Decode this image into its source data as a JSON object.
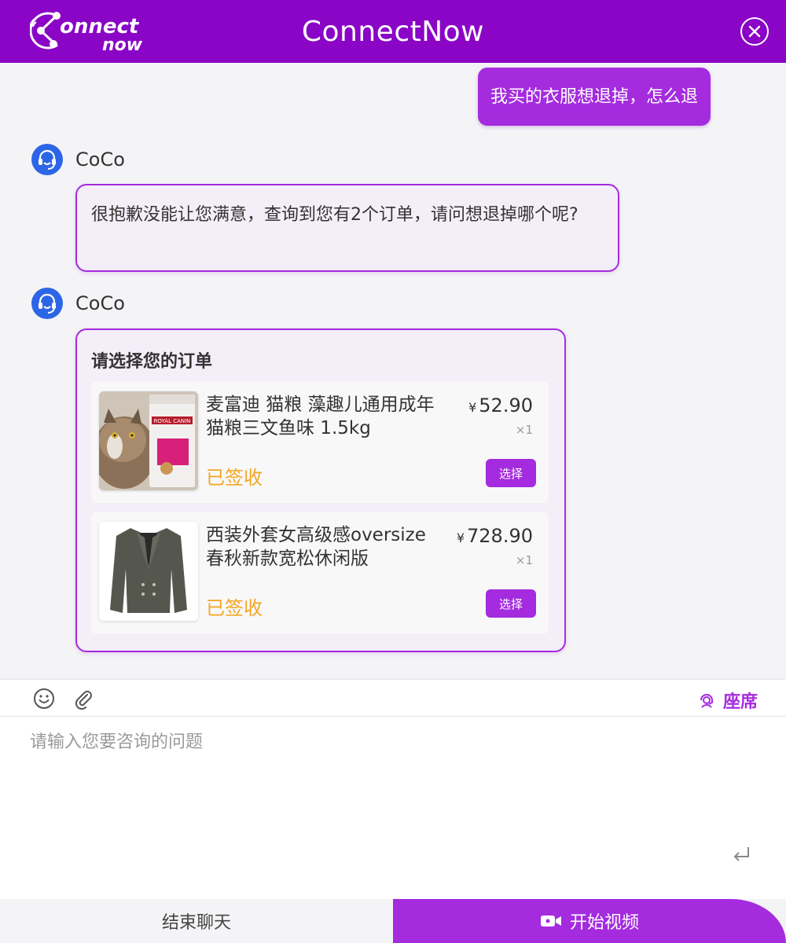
{
  "header": {
    "title": "ConnectNow",
    "logo_text_top": "onnect",
    "logo_text_bottom": "now",
    "logo_icon": "connect-logo",
    "close_icon": "close-circle-icon"
  },
  "chat": {
    "user_message": "我买的衣服想退掉，怎么退",
    "agent_messages": [
      {
        "name": "CoCo",
        "avatar_icon": "headset-icon",
        "text": "很抱歉没能让您满意，查询到您有2个订单，请问想退掉哪个呢?"
      },
      {
        "name": "CoCo",
        "avatar_icon": "headset-icon"
      }
    ],
    "orders": {
      "title": "请选择您的订单",
      "items": [
        {
          "name": "麦富迪 猫粮 藻趣儿通用成年猫粮三文鱼味 1.5kg",
          "currency": "¥",
          "price": "52.90",
          "qty": "×1",
          "status": "已签收",
          "select_label": "选择",
          "image": "cat-food-package",
          "image_text": "ROYAL CANIN"
        },
        {
          "name": "西装外套女高级感oversize春秋新款宽松休闲版",
          "currency": "¥",
          "price": "728.90",
          "qty": "×1",
          "status": "已签收",
          "select_label": "选择",
          "image": "gray-blazer"
        }
      ]
    }
  },
  "toolbar": {
    "emoji_icon": "smile-icon",
    "attach_icon": "paperclip-icon",
    "seat_label": "座席",
    "seat_icon": "agent-icon"
  },
  "input": {
    "placeholder": "请输入您要咨询的问题",
    "value": "",
    "send_icon": "enter-icon"
  },
  "footer": {
    "end_label": "结束聊天",
    "video_label": "开始视频",
    "video_icon": "video-camera-icon"
  },
  "colors": {
    "brand_header": "#8a05c6",
    "accent": "#a52bdf",
    "avatar": "#2c66e6",
    "status": "#f5a623"
  }
}
